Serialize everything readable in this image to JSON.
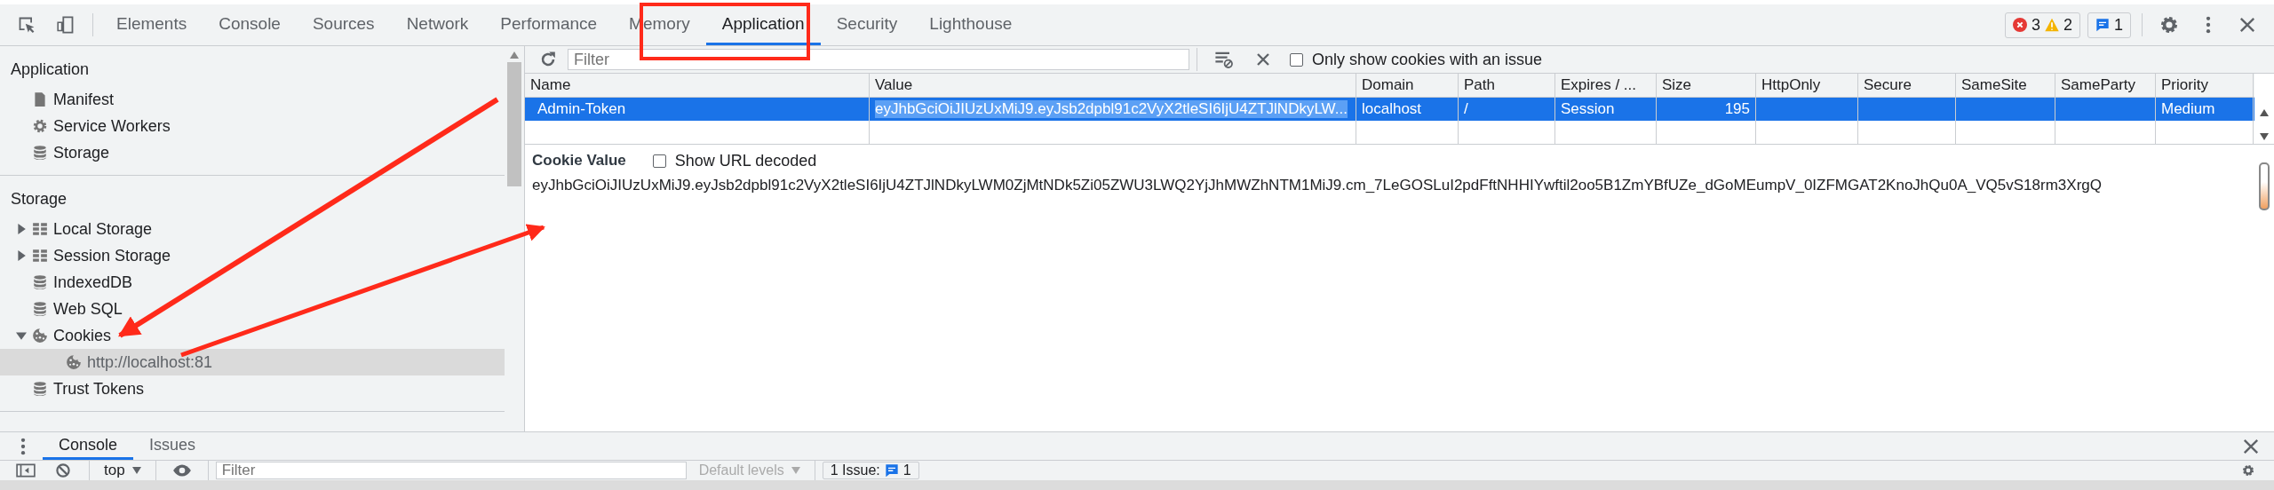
{
  "tabs": [
    {
      "label": "Elements",
      "selected": false
    },
    {
      "label": "Console",
      "selected": false
    },
    {
      "label": "Sources",
      "selected": false
    },
    {
      "label": "Network",
      "selected": false
    },
    {
      "label": "Performance",
      "selected": false
    },
    {
      "label": "Memory",
      "selected": false
    },
    {
      "label": "Application",
      "selected": true
    },
    {
      "label": "Security",
      "selected": false
    },
    {
      "label": "Lighthouse",
      "selected": false
    }
  ],
  "counters": {
    "errors": "3",
    "warnings": "2",
    "issues": "1"
  },
  "sidebar": {
    "sections": [
      {
        "title": "Application",
        "items": [
          {
            "label": "Manifest",
            "kind": "file",
            "selected": false
          },
          {
            "label": "Service Workers",
            "kind": "gear",
            "selected": false
          },
          {
            "label": "Storage",
            "kind": "database",
            "selected": false
          }
        ]
      },
      {
        "title": "Storage",
        "items": [
          {
            "label": "Local Storage",
            "kind": "grid",
            "selected": false,
            "expanded": false
          },
          {
            "label": "Session Storage",
            "kind": "grid",
            "selected": false,
            "expanded": false
          },
          {
            "label": "IndexedDB",
            "kind": "database",
            "selected": false
          },
          {
            "label": "Web SQL",
            "kind": "database",
            "selected": false
          },
          {
            "label": "Cookies",
            "kind": "cookie",
            "selected": false,
            "expanded": true,
            "children": [
              {
                "label": "http://localhost:81",
                "kind": "cookie",
                "selected": true
              }
            ]
          },
          {
            "label": "Trust Tokens",
            "kind": "database",
            "selected": false
          }
        ]
      }
    ]
  },
  "toolbar": {
    "filter_placeholder": "Filter",
    "only_issues_label": "Only show cookies with an issue",
    "only_issues_checked": false
  },
  "table": {
    "columns": [
      "Name",
      "Value",
      "Domain",
      "Path",
      "Expires / ...",
      "Size",
      "HttpOnly",
      "Secure",
      "SameSite",
      "SameParty",
      "Priority"
    ],
    "rows": [
      {
        "selected": true,
        "cells": [
          "Admin-Token",
          "eyJhbGciOiJIUzUxMiJ9.eyJsb2dpbl91c2VyX2tleSI6IjU4ZTJlNDkyLW...",
          "localhost",
          "/",
          "Session",
          "195",
          "",
          "",
          "",
          "",
          "Medium"
        ]
      }
    ]
  },
  "cookie_value": {
    "title": "Cookie Value",
    "decode_label": "Show URL decoded",
    "decode_checked": false,
    "value": "eyJhbGciOiJIUzUxMiJ9.eyJsb2dpbl91c2VyX2tleSI6IjU4ZTJlNDkyLWM0ZjMtNDk5Zi05ZWU3LWQ2YjJhMWZhNTM1MiJ9.cm_7LeGOSLuI2pdFftNHHIYwftil2oo5B1ZmYBfUZe_dGoMEumpV_0IZFMGAT2KnoJhQu0A_VQ5vS18rm3XrgQ"
  },
  "drawer": {
    "tabs": [
      {
        "label": "Console",
        "selected": true
      },
      {
        "label": "Issues",
        "selected": false
      }
    ],
    "context": "top",
    "filter_placeholder": "Filter",
    "levels": "Default levels",
    "issues_label": "1 Issue:",
    "issues_count": "1"
  }
}
